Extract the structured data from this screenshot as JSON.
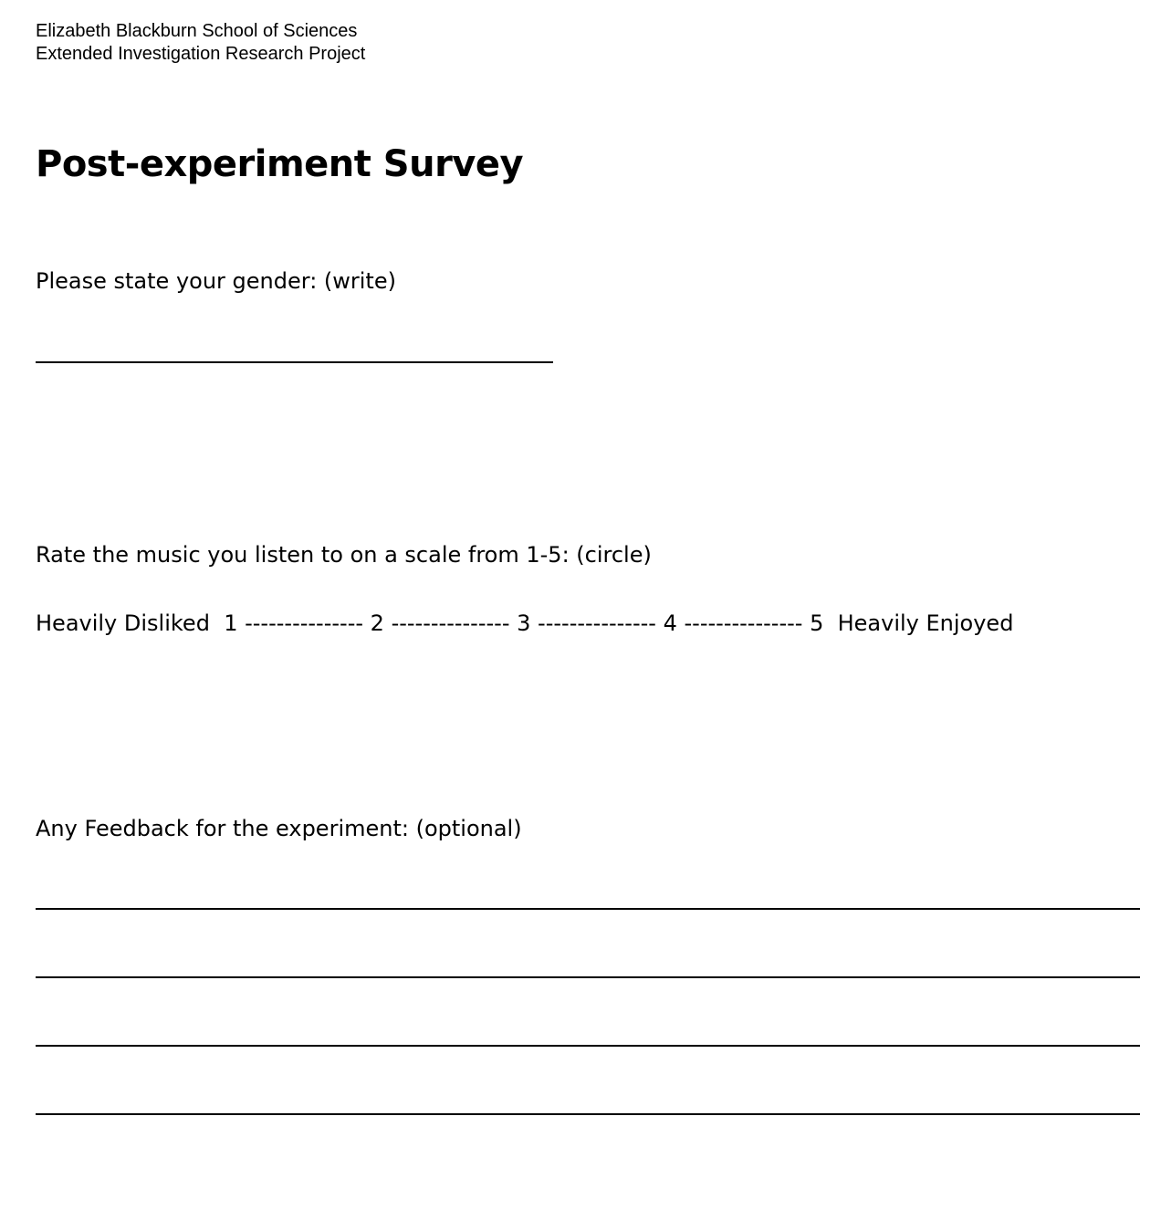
{
  "header": {
    "line1": "Elizabeth Blackburn School of Sciences",
    "line2": "Extended Investigation Research Project"
  },
  "title": "Post-experiment Survey",
  "questions": {
    "gender": "Please state your gender: (write)",
    "rating": "Rate the music you listen to on a scale from 1-5: (circle)",
    "feedback": "Any Feedback for the experiment: (optional)"
  },
  "scale": {
    "low_label": "Heavily Disliked",
    "high_label": "Heavily Enjoyed",
    "points": [
      "1",
      "2",
      "3",
      "4",
      "5"
    ],
    "connector": "---------------"
  }
}
